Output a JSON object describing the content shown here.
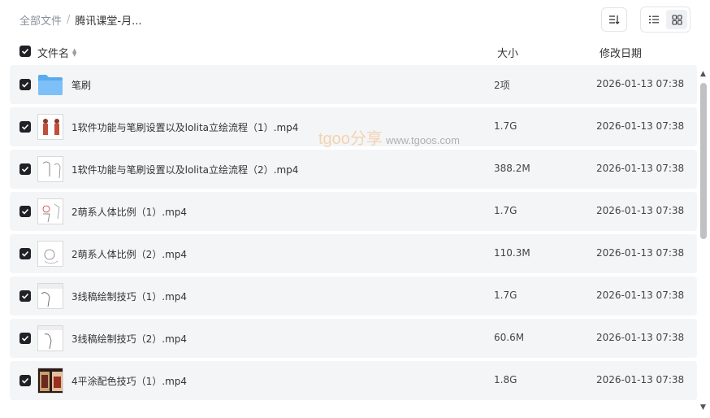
{
  "breadcrumb": {
    "root": "全部文件",
    "separator": "/",
    "current": "腾讯课堂-月..."
  },
  "toolbar": {
    "sort_icon": "sort-icon",
    "list_view_icon": "list-view-icon",
    "grid_view_icon": "grid-view-icon"
  },
  "header": {
    "name": "文件名",
    "size": "大小",
    "date": "修改日期"
  },
  "watermark": {
    "brand": "tgoo分享",
    "url": "www.tgoos.com"
  },
  "files": [
    {
      "name": "笔刷",
      "size": "2项",
      "date": "2026-01-13 07:38",
      "type": "folder",
      "checked": true
    },
    {
      "name": "1软件功能与笔刷设置以及lolita立绘流程（1）.mp4",
      "size": "1.7G",
      "date": "2026-01-13 07:38",
      "type": "video",
      "checked": true
    },
    {
      "name": "1软件功能与笔刷设置以及lolita立绘流程（2）.mp4",
      "size": "388.2M",
      "date": "2026-01-13 07:38",
      "type": "video",
      "checked": true
    },
    {
      "name": "2萌系人体比例（1）.mp4",
      "size": "1.7G",
      "date": "2026-01-13 07:38",
      "type": "video",
      "checked": true
    },
    {
      "name": "2萌系人体比例（2）.mp4",
      "size": "110.3M",
      "date": "2026-01-13 07:38",
      "type": "video",
      "checked": true
    },
    {
      "name": "3线稿绘制技巧（1）.mp4",
      "size": "1.7G",
      "date": "2026-01-13 07:38",
      "type": "video",
      "checked": true
    },
    {
      "name": "3线稿绘制技巧（2）.mp4",
      "size": "60.6M",
      "date": "2026-01-13 07:38",
      "type": "video",
      "checked": true
    },
    {
      "name": "4平涂配色技巧（1）.mp4",
      "size": "1.8G",
      "date": "2026-01-13 07:38",
      "type": "video",
      "checked": true
    }
  ]
}
